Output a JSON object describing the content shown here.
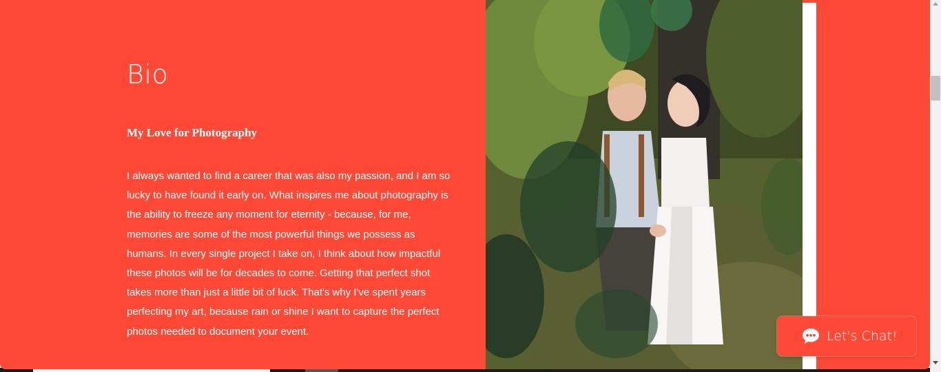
{
  "bio": {
    "title": "Bio",
    "subtitle": "My Love for Photography",
    "text": "I always wanted to find a career that was also my passion, and I am so lucky to have found it early on. What inspires me about photography is the ability to freeze any moment for eternity - because, for me, memories are some of the most powerful things we possess as humans. In every single project I take on, I think about how impactful these photos will be for decades to come. Getting that perfect shot takes more than just a little bit of luck. That's why I've spent years perfecting my art, because rain or shine I want to capture the perfect photos needed to document your event."
  },
  "chat": {
    "label": "Let's Chat!",
    "icon": "chat-bubble-icon"
  },
  "colors": {
    "section_background": "#ff4936",
    "text": "#ffffff"
  }
}
